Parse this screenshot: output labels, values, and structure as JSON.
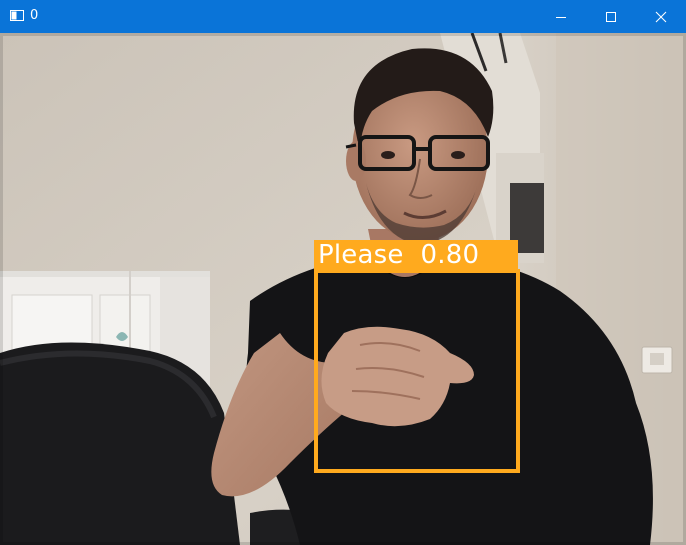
{
  "window": {
    "title": "0",
    "titlebar_color": "#0a74d8",
    "buttons": [
      "minimize",
      "maximize",
      "close"
    ],
    "icons": {
      "app": "window-app-icon",
      "minimize": "minimize-icon",
      "maximize": "maximize-icon",
      "close": "close-icon"
    }
  },
  "detection": {
    "class_label": "Please",
    "confidence": "0.80",
    "box_color": "#ffaa1e",
    "label_text_color": "#ffffff"
  }
}
